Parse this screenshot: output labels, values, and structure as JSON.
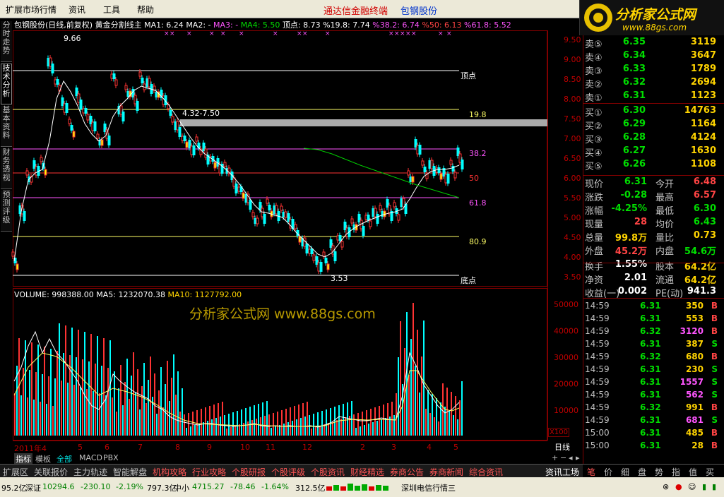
{
  "menu": [
    "扩展市场行情",
    "资讯",
    "工具",
    "帮助"
  ],
  "app_title": "通达信金融终端",
  "stock_name": "包钢股份",
  "logo": {
    "name": "分析家公式网",
    "url": "www.88gs.com"
  },
  "side_tabs": [
    "分时走势",
    "技术分析",
    "基本资料",
    "财务透视",
    "预测评级"
  ],
  "chart_header": {
    "title": "包钢股份(日线,前复权)",
    "indicator": "黄金分割线主",
    "ma1": "MA1: 6.24",
    "ma2": "MA2: -",
    "ma3": "MA3: -",
    "ma4": "MA4: 5.50",
    "top": "顶点: 8.73",
    "p19": "%19.8: 7.74",
    "p38": "%38.2: 6.74",
    "p50": "%50: 6.13",
    "p61": "%61.8: 5.52"
  },
  "chart_annotations": {
    "high": "9.66",
    "low": "3.53",
    "range": "4.32-7.50",
    "top_label": "顶点",
    "l198": "19.8",
    "l382": "38.2",
    "l50": "50",
    "l618": "61.8",
    "l809": "80.9",
    "base": "底点"
  },
  "volume_header": {
    "volume": "VOLUME: 998388.00",
    "ma5": "MA5: 1232070.38",
    "ma10": "MA10: 1127792.00"
  },
  "watermark": "分析家公式网 www.88gs.com",
  "price_axis": [
    "9.50",
    "9.00",
    "8.50",
    "8.00",
    "7.50",
    "7.00",
    "6.50",
    "6.00",
    "5.50",
    "5.00",
    "4.50",
    "4.00",
    "3.50"
  ],
  "volume_axis": [
    "50000",
    "40000",
    "30000",
    "20000",
    "10000"
  ],
  "x100": "X100",
  "time_axis": [
    "2011年4",
    "5",
    "6",
    "7",
    "8",
    "9",
    "10",
    "11",
    "12",
    "2",
    "3",
    "4",
    "5"
  ],
  "day_label": "日线",
  "indicator_tabs": [
    "指标",
    "模板",
    "全部",
    "MACD",
    "PBX"
  ],
  "function_bar": [
    "扩展区",
    "关联报价",
    "主力轨迹",
    "智能解盘",
    "机构攻略",
    "行业攻略",
    "个股研报",
    "个股评级",
    "个股资讯",
    "财经精选",
    "券商公告",
    "券商新闻",
    "综合资讯",
    "资讯工场"
  ],
  "order_book": {
    "sells": [
      {
        "label": "卖⑤",
        "price": "6.35",
        "vol": "3119"
      },
      {
        "label": "卖④",
        "price": "6.34",
        "vol": "3647"
      },
      {
        "label": "卖③",
        "price": "6.33",
        "vol": "1789"
      },
      {
        "label": "卖②",
        "price": "6.32",
        "vol": "2694"
      },
      {
        "label": "卖①",
        "price": "6.31",
        "vol": "1123"
      }
    ],
    "buys": [
      {
        "label": "买①",
        "price": "6.30",
        "vol": "14763"
      },
      {
        "label": "买②",
        "price": "6.29",
        "vol": "1164"
      },
      {
        "label": "买③",
        "price": "6.28",
        "vol": "4124"
      },
      {
        "label": "买④",
        "price": "6.27",
        "vol": "1630"
      },
      {
        "label": "买⑤",
        "price": "6.26",
        "vol": "1108"
      }
    ]
  },
  "quote": [
    {
      "l1": "现价",
      "v1": "6.31",
      "l2": "今开",
      "v2": "6.48"
    },
    {
      "l1": "涨跌",
      "v1": "-0.28",
      "l2": "最高",
      "v2": "6.57"
    },
    {
      "l1": "涨幅",
      "v1": "-4.25%",
      "l2": "最低",
      "v2": "6.30"
    },
    {
      "l1": "现量",
      "v1": "28",
      "l2": "均价",
      "v2": "6.43"
    },
    {
      "l1": "总量",
      "v1": "99.8万",
      "l2": "量比",
      "v2": "0.73"
    },
    {
      "l1": "外盘",
      "v1": "45.2万",
      "l2": "内盘",
      "v2": "54.6万"
    },
    {
      "l1": "换手",
      "v1": "1.55%",
      "l2": "股本",
      "v2": "64.2亿"
    },
    {
      "l1": "净资",
      "v1": "2.01",
      "l2": "流通",
      "v2": "64.2亿"
    },
    {
      "l1": "收益(一)",
      "v1": "0.002",
      "l2": "PE(动)",
      "v2": "941.3"
    }
  ],
  "ticks": [
    {
      "t": "14:59",
      "p": "6.31",
      "v": "350",
      "s": "B"
    },
    {
      "t": "14:59",
      "p": "6.31",
      "v": "553",
      "s": "B"
    },
    {
      "t": "14:59",
      "p": "6.32",
      "v": "3120",
      "s": "B"
    },
    {
      "t": "14:59",
      "p": "6.31",
      "v": "387",
      "s": "S"
    },
    {
      "t": "14:59",
      "p": "6.32",
      "v": "680",
      "s": "B"
    },
    {
      "t": "14:59",
      "p": "6.31",
      "v": "230",
      "s": "S"
    },
    {
      "t": "14:59",
      "p": "6.31",
      "v": "1557",
      "s": "S"
    },
    {
      "t": "14:59",
      "p": "6.31",
      "v": "562",
      "s": "S"
    },
    {
      "t": "14:59",
      "p": "6.32",
      "v": "991",
      "s": "B"
    },
    {
      "t": "14:59",
      "p": "6.31",
      "v": "681",
      "s": "S"
    },
    {
      "t": "15:00",
      "p": "6.31",
      "v": "485",
      "s": "B"
    },
    {
      "t": "15:00",
      "p": "6.31",
      "v": "28",
      "s": "B"
    }
  ],
  "right_tabs": [
    "笔",
    "价",
    "细",
    "盘",
    "势",
    "指",
    "值",
    "买"
  ],
  "status": {
    "s0": "95.2亿",
    "sz_label": "深证",
    "sz_val": "10294.6",
    "sz_chg": "-230.10",
    "sz_pct": "-2.19%",
    "sz_amt": "797.3亿",
    "zx_label": "中小",
    "zx_val": "4715.27",
    "zx_chg": "-78.46",
    "zx_pct": "-1.64%",
    "zx_amt": "312.5亿",
    "server": "深圳电信行情三"
  },
  "colors": {
    "up": "#ff3333",
    "down": "#00ffff",
    "ma_line": "#ffffff",
    "ma4_line": "#00cc00",
    "gold_line": "#ffff00",
    "pink_line": "#ff55ff"
  }
}
